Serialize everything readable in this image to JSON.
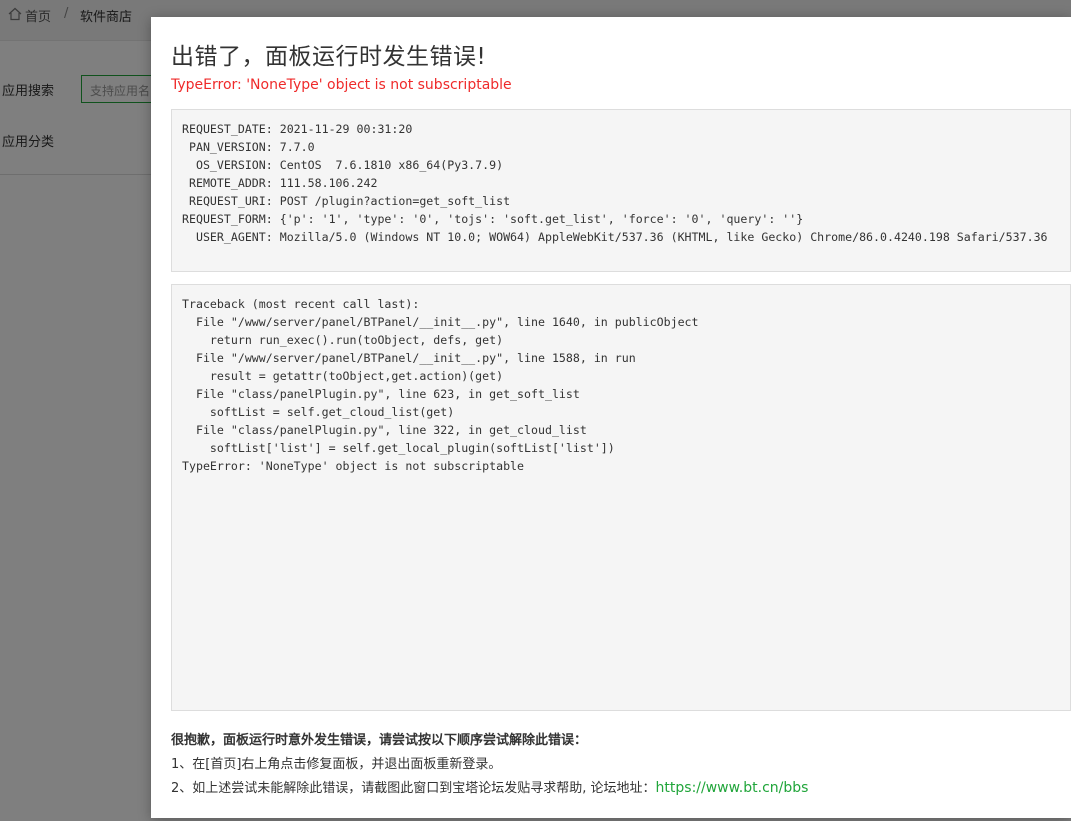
{
  "background": {
    "breadcrumb": {
      "home": "首页",
      "separator": "/",
      "current": "软件商店"
    },
    "search_label": "应用搜索",
    "search_placeholder": "支持应用名",
    "category_label": "应用分类"
  },
  "modal": {
    "title": "出错了，面板运行时发生错误!",
    "error_message": "TypeError: 'NoneType' object is not subscriptable",
    "request_info": [
      "REQUEST_DATE: 2021-11-29 00:31:20",
      " PAN_VERSION: 7.7.0",
      "  OS_VERSION: CentOS  7.6.1810 x86_64(Py3.7.9)",
      " REMOTE_ADDR: 111.58.106.242",
      " REQUEST_URI: POST /plugin?action=get_soft_list",
      "REQUEST_FORM: {'p': '1', 'type': '0', 'tojs': 'soft.get_list', 'force': '0', 'query': ''}",
      "  USER_AGENT: Mozilla/5.0 (Windows NT 10.0; WOW64) AppleWebKit/537.36 (KHTML, like Gecko) Chrome/86.0.4240.198 Safari/537.36"
    ],
    "traceback": [
      "Traceback (most recent call last):",
      "  File \"/www/server/panel/BTPanel/__init__.py\", line 1640, in publicObject",
      "    return run_exec().run(toObject, defs, get)",
      "  File \"/www/server/panel/BTPanel/__init__.py\", line 1588, in run",
      "    result = getattr(toObject,get.action)(get)",
      "  File \"class/panelPlugin.py\", line 623, in get_soft_list",
      "    softList = self.get_cloud_list(get)",
      "  File \"class/panelPlugin.py\", line 322, in get_cloud_list",
      "    softList['list'] = self.get_local_plugin(softList['list'])",
      "TypeError: 'NoneType' object is not subscriptable"
    ],
    "help_title": "很抱歉，面板运行时意外发生错误，请尝试按以下顺序尝试解除此错误：",
    "help_step1": "1、在[首页]右上角点击修复面板，并退出面板重新登录。",
    "help_step2": "2、如上述尝试未能解除此错误，请截图此窗口到宝塔论坛发贴寻求帮助, 论坛地址：",
    "help_link": "https://www.bt.cn/bbs"
  },
  "colors": {
    "error_red": "#ef2a2a",
    "accent_green": "#20a53a"
  },
  "icons": {
    "breadcrumb_home": "home-icon"
  }
}
